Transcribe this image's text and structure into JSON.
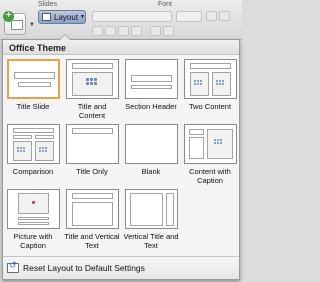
{
  "ribbon": {
    "group_slides_label": "Slides",
    "group_font_label": "Font",
    "new_slide_plus": "+",
    "layout_button_label": "Layout"
  },
  "panel": {
    "theme_name": "Office Theme",
    "layouts": [
      {
        "name": "Title Slide",
        "selected": true
      },
      {
        "name": "Title and Content"
      },
      {
        "name": "Section Header"
      },
      {
        "name": "Two Content"
      },
      {
        "name": "Comparison"
      },
      {
        "name": "Title Only"
      },
      {
        "name": "Blank"
      },
      {
        "name": "Content with Caption"
      },
      {
        "name": "Picture with Caption"
      },
      {
        "name": "Title and Vertical Text"
      },
      {
        "name": "Vertical Title and Text"
      }
    ],
    "reset_label": "Reset Layout to Default Settings"
  },
  "colors": {
    "selection": "#e8a34a",
    "layout_button": "#9aaecb",
    "content_dots": "#6a86b8"
  }
}
